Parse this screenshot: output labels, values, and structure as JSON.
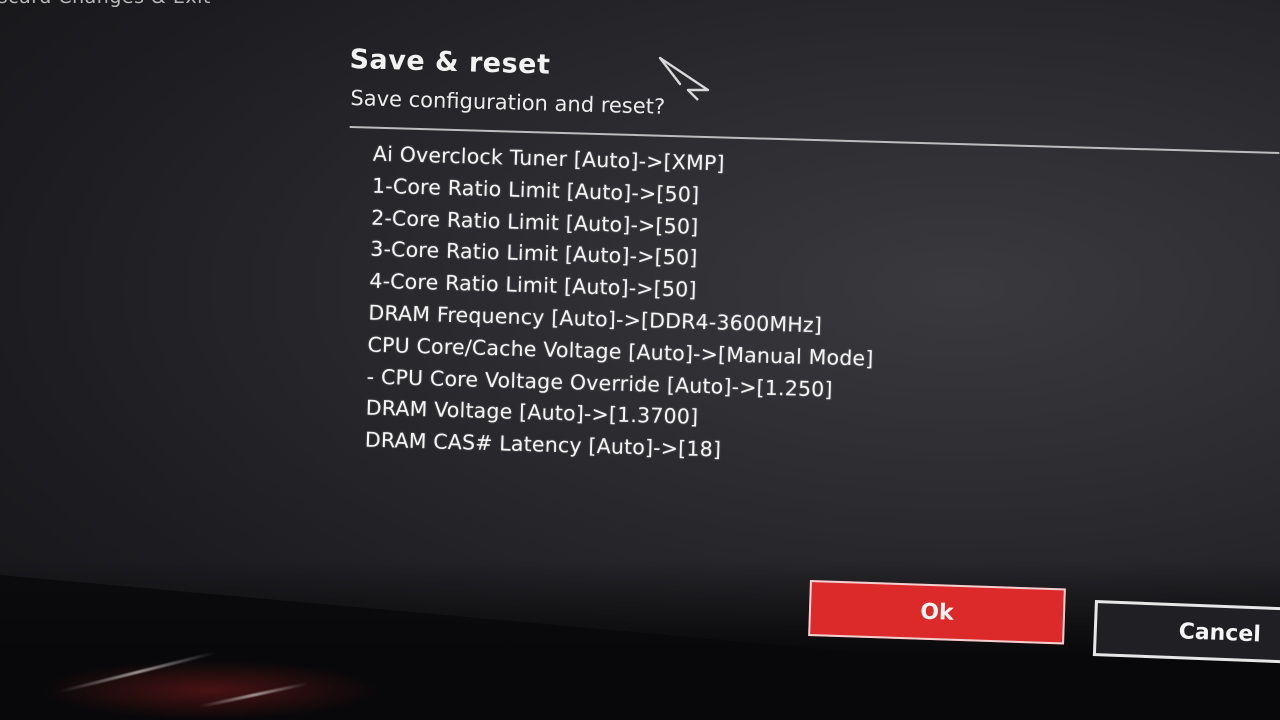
{
  "menu": {
    "fragment_label": "iscard Changes & Exit"
  },
  "dialog": {
    "title": "Save & reset",
    "subtitle": "Save configuration and reset?",
    "changes": [
      "Ai Overclock Tuner [Auto]->[XMP]",
      "1-Core Ratio Limit [Auto]->[50]",
      "2-Core Ratio Limit [Auto]->[50]",
      "3-Core Ratio Limit [Auto]->[50]",
      "4-Core Ratio Limit [Auto]->[50]",
      "DRAM Frequency [Auto]->[DDR4-3600MHz]",
      "CPU Core/Cache Voltage [Auto]->[Manual Mode]",
      "- CPU Core Voltage Override [Auto]->[1.250]",
      "DRAM Voltage [Auto]->[1.3700]",
      "DRAM CAS# Latency [Auto]->[18]"
    ],
    "ok_label": "Ok",
    "cancel_label": "Cancel"
  },
  "icons": {
    "cursor": "mouse-pointer-icon"
  },
  "colors": {
    "ok_button": "#dc2a2a",
    "background": "#2c2c30",
    "text": "#f4f4f4"
  }
}
